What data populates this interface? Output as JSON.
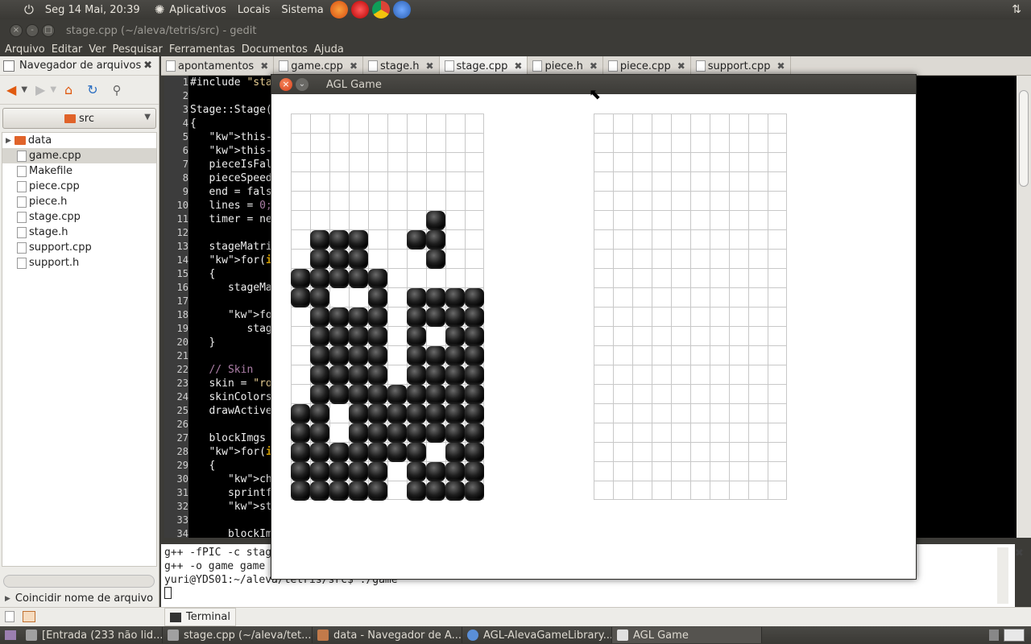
{
  "top_panel": {
    "datetime": "Seg 14 Mai, 20:39",
    "menus": [
      "Aplicativos",
      "Locais",
      "Sistema"
    ]
  },
  "gedit": {
    "title": "stage.cpp (~/aleva/tetris/src) - gedit",
    "menu": [
      "Arquivo",
      "Editar",
      "Ver",
      "Pesquisar",
      "Ferramentas",
      "Documentos",
      "Ajuda"
    ],
    "side_title": "Navegador de arquivos",
    "folder": "src",
    "files": [
      "data",
      "game.cpp",
      "Makefile",
      "piece.cpp",
      "piece.h",
      "stage.cpp",
      "stage.h",
      "support.cpp",
      "support.h"
    ],
    "filter_label": "Coincidir nome de arquivo",
    "tabs": [
      "apontamentos",
      "game.cpp",
      "stage.h",
      "stage.cpp",
      "piece.h",
      "piece.cpp",
      "support.cpp"
    ],
    "active_tab": 3,
    "line_numbers": [
      "1",
      "2",
      "3",
      "4",
      "5",
      "6",
      "7",
      "8",
      "9",
      "10",
      "11",
      "12",
      "13",
      "14",
      "15",
      "16",
      "17",
      "18",
      "19",
      "20",
      "21",
      "22",
      "23",
      "24",
      "25",
      "26",
      "27",
      "28",
      "29",
      "30",
      "31",
      "32",
      "33",
      "34"
    ],
    "code_lines": [
      "#include \"sta",
      "",
      "Stage::Stage(",
      "{",
      "   this->game",
      "   this->draw",
      "   pieceIsFal",
      "   pieceSpeed",
      "   end = fals",
      "   lines = 0;",
      "   timer = ne",
      "",
      "   stageMatri",
      "   for(int i ",
      "   {",
      "      stageMa",
      "",
      "      for(int",
      "         stag",
      "   }",
      "",
      "   // Skin",
      "   skin = \"ro",
      "   skinColors",
      "   drawActive",
      "",
      "   blockImgs ",
      "   for(int i ",
      "   {",
      "      char st",
      "      sprintf",
      "      string ",
      "",
      "      blockIm"
    ],
    "terminal_lines": [
      "g++ -fPIC -c stag",
      "g++ -o game game",
      "yuri@YDS01:~/aleva/tetris/src$ ./game",
      ""
    ],
    "terminal_tab": "Terminal"
  },
  "agl": {
    "title": "AGL Game",
    "board_blocks": [
      "..........",
      "..........",
      "..........",
      "..........",
      "..........",
      "..........",
      ".......#..",
      ".###..##..",
      ".###...#..",
      "#####.....",
      "##..#.####",
      ".####.####",
      ".####.#.##",
      ".####.####",
      ".####.####",
      ".#########",
      "##.#######",
      "##.#######",
      "#######.##",
      "#####.####",
      "#####.####"
    ]
  },
  "taskbar": [
    "[Entrada (233 não lid...",
    "stage.cpp (~/aleva/tet...",
    "data - Navegador de A...",
    "AGL-AlevaGameLibrary...",
    "AGL Game"
  ]
}
